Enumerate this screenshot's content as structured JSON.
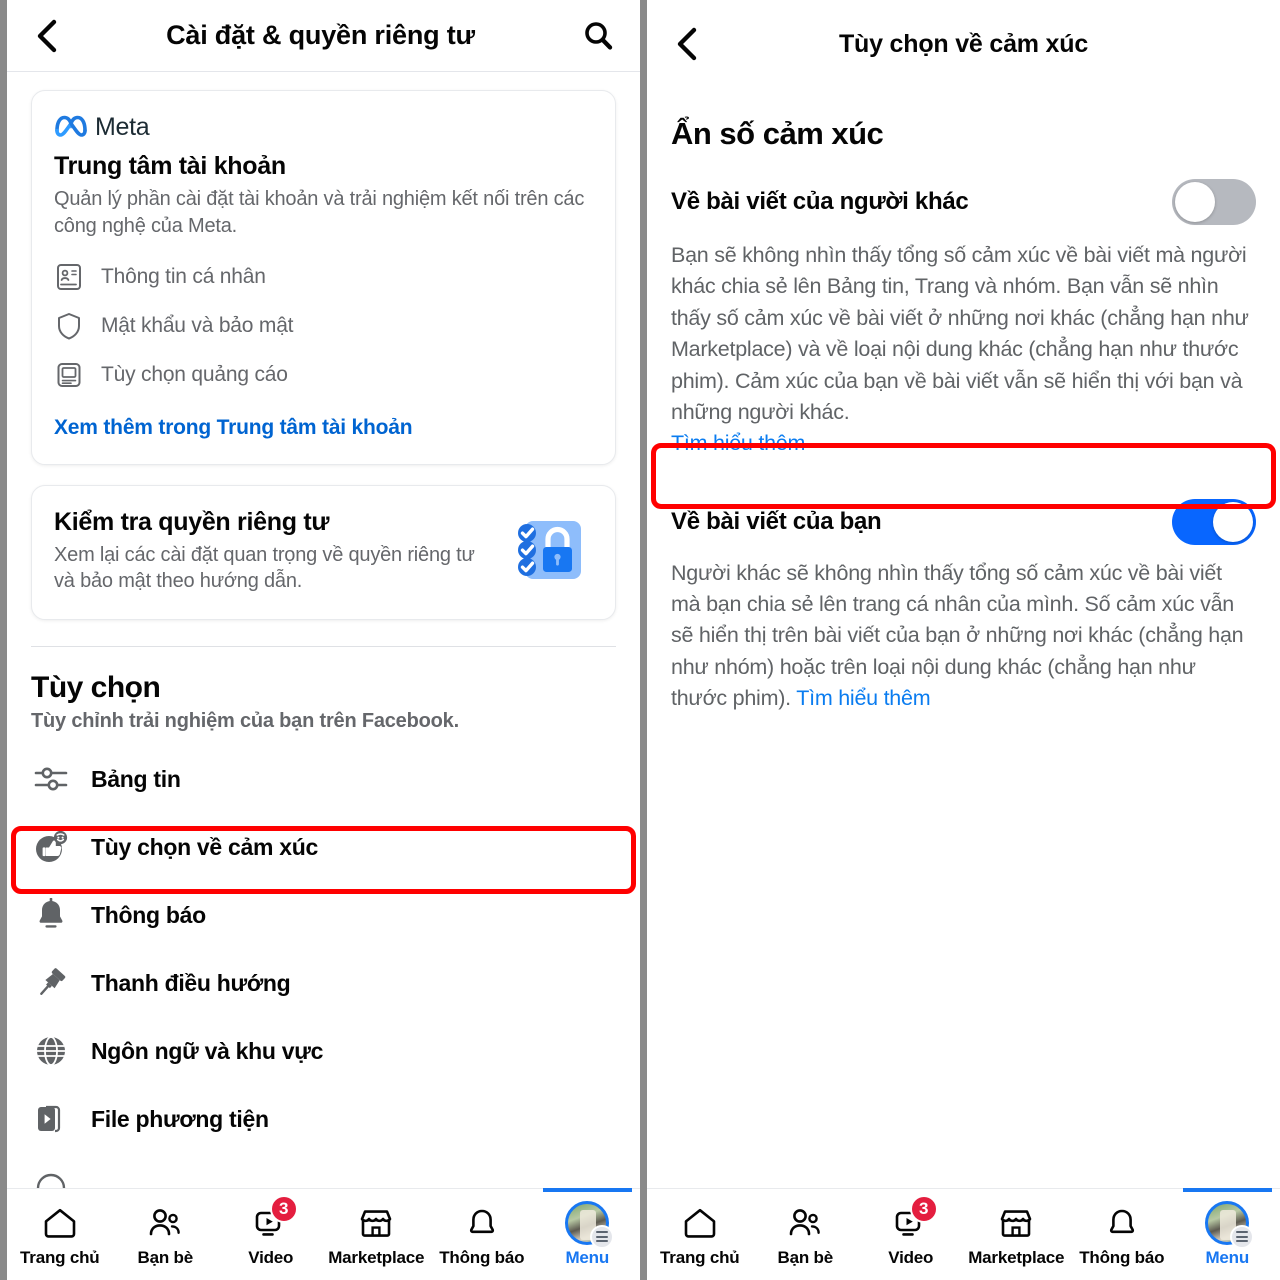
{
  "left": {
    "header": {
      "back_icon": "chevron-left-icon",
      "title": "Cài đặt & quyền riêng tư",
      "search_icon": "search-icon"
    },
    "account_center_card": {
      "brand": "Meta",
      "brand_icon": "meta-infinity-icon",
      "title": "Trung tâm tài khoản",
      "description": "Quản lý phần cài đặt tài khoản và trải nghiệm kết nối trên các công nghệ của Meta.",
      "links": [
        {
          "icon": "id-card-icon",
          "label": "Thông tin cá nhân"
        },
        {
          "icon": "shield-icon",
          "label": "Mật khẩu và bảo mật"
        },
        {
          "icon": "ad-preferences-icon",
          "label": "Tùy chọn quảng cáo"
        }
      ],
      "see_more": "Xem thêm trong Trung tâm tài khoản"
    },
    "privacy_checkup_card": {
      "title": "Kiểm tra quyền riêng tư",
      "description": "Xem lại các cài đặt quan trọng về quyền riêng tư và bảo mật theo hướng dẫn.",
      "icon": "privacy-checklist-lock-icon"
    },
    "preferences_section": {
      "title": "Tùy chọn",
      "subtitle": "Tùy chỉnh trải nghiệm của bạn trên Facebook.",
      "items": [
        {
          "icon": "sliders-icon",
          "label": "Bảng tin",
          "highlighted": false
        },
        {
          "icon": "thumbs-up-reaction-icon",
          "label": "Tùy chọn về cảm xúc",
          "highlighted": true
        },
        {
          "icon": "bell-icon",
          "label": "Thông báo",
          "highlighted": false
        },
        {
          "icon": "pin-icon",
          "label": "Thanh điều hướng",
          "highlighted": false
        },
        {
          "icon": "globe-icon",
          "label": "Ngôn ngữ và khu vực",
          "highlighted": false
        },
        {
          "icon": "media-file-icon",
          "label": "File phương tiện",
          "highlighted": false
        }
      ]
    }
  },
  "right": {
    "header": {
      "back_icon": "chevron-left-icon",
      "title": "Tùy chọn về cảm xúc"
    },
    "section_title": "Ẩn số cảm xúc",
    "settings": [
      {
        "label": "Về bài viết của người khác",
        "toggle_state": "off",
        "highlighted": false,
        "description": "Bạn sẽ không nhìn thấy tổng số cảm xúc về bài viết mà người khác chia sẻ lên Bảng tin, Trang và nhóm. Bạn vẫn sẽ nhìn thấy số cảm xúc về bài viết ở những nơi khác (chẳng hạn như Marketplace) và về loại nội dung khác (chẳng hạn như thước phim). Cảm xúc của bạn về bài viết vẫn sẽ hiển thị với bạn và những người khác. ",
        "learn_more": "Tìm hiểu thêm",
        "learn_more_position": "newline"
      },
      {
        "label": "Về bài viết của bạn",
        "toggle_state": "on",
        "highlighted": true,
        "description": "Người khác sẽ không nhìn thấy tổng số cảm xúc về bài viết mà bạn chia sẻ lên trang cá nhân của mình. Số cảm xúc vẫn sẽ hiển thị trên bài viết của bạn ở những nơi khác (chẳng hạn như nhóm) hoặc trên loại nội dung khác (chẳng hạn như thước phim). ",
        "learn_more": "Tìm hiểu thêm",
        "learn_more_position": "inline"
      }
    ]
  },
  "bottom_nav": {
    "tabs": [
      {
        "icon": "home-icon",
        "label": "Trang chủ",
        "badge": "",
        "active": false
      },
      {
        "icon": "friends-icon",
        "label": "Bạn bè",
        "badge": "",
        "active": false
      },
      {
        "icon": "video-icon",
        "label": "Video",
        "badge": "3",
        "active": false
      },
      {
        "icon": "marketplace-icon",
        "label": "Marketplace",
        "badge": "",
        "active": false
      },
      {
        "icon": "bell-icon",
        "label": "Thông báo",
        "badge": "",
        "active": false
      },
      {
        "icon": "avatar-menu-icon",
        "label": "Menu",
        "badge": "",
        "active": true
      }
    ]
  },
  "colors": {
    "facebook_blue": "#1877f2",
    "toggle_on": "#0866ff",
    "toggle_off": "#b6b9bf",
    "link_blue": "#0a7cf0",
    "highlight_red": "#ff0000",
    "badge_red": "#e41e3f",
    "text_primary": "#050505",
    "text_secondary": "#65676b"
  }
}
